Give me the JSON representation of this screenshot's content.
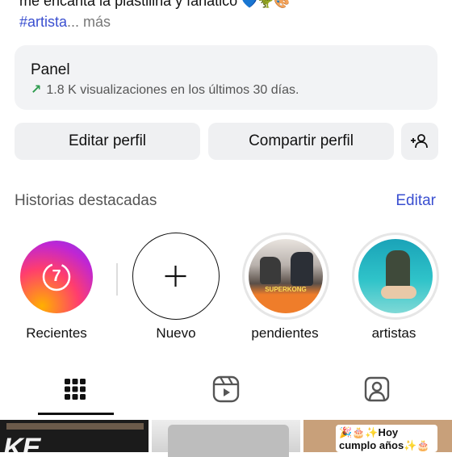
{
  "bio": {
    "line1": "me encanta la plastilina y fanático",
    "line1_emoji": "💙🦖🎨",
    "hashtag": "#artista",
    "more": "... más"
  },
  "panel": {
    "title": "Panel",
    "stats": "1.8 K visualizaciones en los últimos 30 días."
  },
  "buttons": {
    "edit_profile": "Editar perfil",
    "share_profile": "Compartir perfil"
  },
  "highlights": {
    "title": "Historias destacadas",
    "edit": "Editar",
    "items": [
      {
        "label": "Recientes",
        "badge": "7"
      },
      {
        "label": "Nuevo"
      },
      {
        "label": "pendientes",
        "cover_text": "SUPERKONG"
      },
      {
        "label": "artistas"
      }
    ]
  },
  "tabs": [
    "grid",
    "reels",
    "tagged"
  ],
  "posts": [
    {
      "text": "KE"
    },
    {
      "text": ""
    },
    {
      "text": "🎉🎂✨Hoy cumplo años✨🎂🎉"
    }
  ],
  "colors": {
    "accent": "#3a4fd0",
    "trend": "#2e9b4e"
  }
}
